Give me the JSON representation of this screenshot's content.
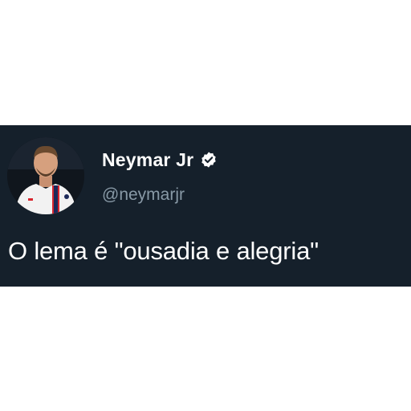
{
  "tweet": {
    "author_name": "Neymar Jr",
    "handle": "@neymarjr",
    "text": "O lema é \"ousadia e alegria\"",
    "verified": true,
    "verified_icon": "verified-badge-icon"
  },
  "colors": {
    "card_background": "#15202b",
    "name": "#ffffff",
    "handle": "#8899a6",
    "text": "#ffffff",
    "page_background": "#ffffff"
  }
}
